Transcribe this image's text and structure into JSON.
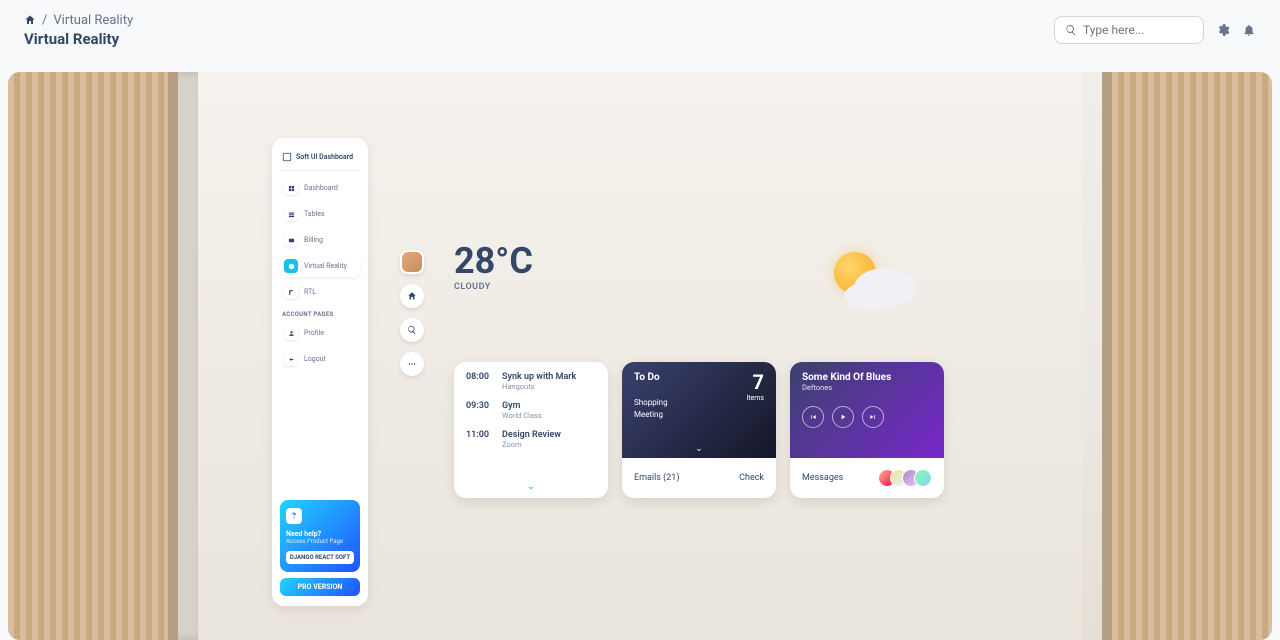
{
  "breadcrumb": {
    "item": "Virtual Reality",
    "title": "Virtual Reality"
  },
  "search": {
    "placeholder": "Type here..."
  },
  "sidebar": {
    "brand": "Soft UI Dashboard",
    "items": [
      {
        "label": "Dashboard"
      },
      {
        "label": "Tables"
      },
      {
        "label": "Billing"
      },
      {
        "label": "Virtual Reality"
      },
      {
        "label": "RTL"
      }
    ],
    "section": "Account Pages",
    "account": [
      {
        "label": "Profile"
      },
      {
        "label": "Logout"
      }
    ],
    "help": {
      "title": "Need help?",
      "subtitle": "Access Product Page",
      "cta": "DJANGO REACT SOFT"
    },
    "pro": "PRO VERSION"
  },
  "weather": {
    "temp": "28°C",
    "desc": "CLOUDY"
  },
  "schedule": [
    {
      "time": "08:00",
      "title": "Synk up with Mark",
      "sub": "Hangouts"
    },
    {
      "time": "09:30",
      "title": "Gym",
      "sub": "World Class"
    },
    {
      "time": "11:00",
      "title": "Design Review",
      "sub": "Zoom"
    }
  ],
  "todo": {
    "title": "To Do",
    "count": "7",
    "count_label": "Items",
    "items": [
      "Shopping",
      "Meeting"
    ],
    "emails_label": "Emails (21)",
    "check": "Check"
  },
  "music": {
    "title": "Some Kind Of Blues",
    "artist": "Deftones",
    "messages": "Messages"
  }
}
